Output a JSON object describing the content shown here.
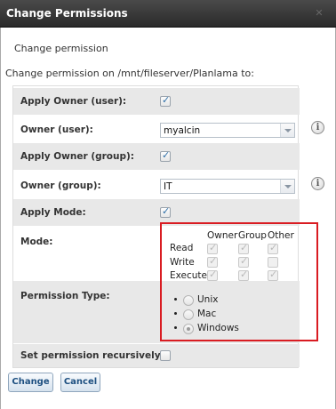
{
  "window": {
    "title": "Change Permissions",
    "close_icon": "close-icon"
  },
  "subtitle": "Change permission",
  "description": "Change permission on /mnt/fileserver/Planlama to:",
  "form": {
    "apply_owner_user": {
      "label": "Apply Owner (user):",
      "checked": true
    },
    "owner_user": {
      "label": "Owner (user):",
      "value": "myalcin",
      "info_icon": "info-icon"
    },
    "apply_owner_group": {
      "label": "Apply Owner (group):",
      "checked": true
    },
    "owner_group": {
      "label": "Owner (group):",
      "value": "IT",
      "info_icon": "info-icon"
    },
    "apply_mode": {
      "label": "Apply Mode:",
      "checked": true
    },
    "mode": {
      "label": "Mode:",
      "columns": [
        "Owner",
        "Group",
        "Other"
      ],
      "rows": [
        {
          "name": "Read",
          "values": [
            true,
            true,
            true
          ]
        },
        {
          "name": "Write",
          "values": [
            true,
            true,
            false
          ]
        },
        {
          "name": "Execute",
          "values": [
            true,
            true,
            true
          ]
        }
      ]
    },
    "permission_type": {
      "label": "Permission Type:",
      "options": [
        "Unix",
        "Mac",
        "Windows"
      ],
      "selected": "Windows"
    },
    "recursive": {
      "label": "Set permission recursively:",
      "checked": false
    }
  },
  "buttons": {
    "change": "Change",
    "cancel": "Cancel"
  },
  "colors": {
    "highlight": "#d91c22",
    "shaded_row": "#e8e8e8",
    "titlebar": "#2a2a2a"
  }
}
